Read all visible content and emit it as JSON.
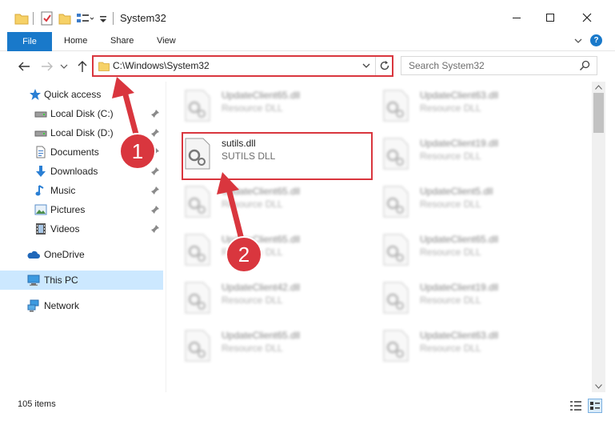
{
  "window": {
    "title": "System32"
  },
  "ribbon": {
    "tabs": [
      "File",
      "Home",
      "Share",
      "View"
    ],
    "help": "?"
  },
  "address_bar": {
    "path": "C:\\Windows\\System32",
    "search_placeholder": "Search System32"
  },
  "sidebar": {
    "items": [
      {
        "label": "Quick access",
        "icon": "star-icon",
        "pinned": false
      },
      {
        "label": "Local Disk (C:)",
        "icon": "drive-icon",
        "pinned": true
      },
      {
        "label": "Local Disk (D:)",
        "icon": "drive-icon",
        "pinned": true
      },
      {
        "label": "Documents",
        "icon": "documents-icon",
        "pinned": true
      },
      {
        "label": "Downloads",
        "icon": "download-icon",
        "pinned": true
      },
      {
        "label": "Music",
        "icon": "music-icon",
        "pinned": true
      },
      {
        "label": "Pictures",
        "icon": "pictures-icon",
        "pinned": true
      },
      {
        "label": "Videos",
        "icon": "videos-icon",
        "pinned": true
      },
      {
        "label": "OneDrive",
        "icon": "cloud-icon",
        "pinned": false
      },
      {
        "label": "This PC",
        "icon": "computer-icon",
        "pinned": false,
        "selected": true
      },
      {
        "label": "Network",
        "icon": "network-icon",
        "pinned": false
      }
    ]
  },
  "files": {
    "left_column": [
      {
        "name": "UpdateClient65.dll",
        "type": "Resource DLL",
        "blurred": true
      },
      {
        "name": "sutils.dll",
        "type": "SUTILS DLL",
        "blurred": false,
        "highlighted": true
      },
      {
        "name": "UpdateClient65.dll",
        "type": "Resource DLL",
        "blurred": true
      },
      {
        "name": "UpdateClient65.dll",
        "type": "Resource DLL",
        "blurred": true
      },
      {
        "name": "UpdateClient42.dll",
        "type": "Resource DLL",
        "blurred": true
      },
      {
        "name": "UpdateClient65.dll",
        "type": "Resource DLL",
        "blurred": true
      }
    ],
    "right_column": [
      {
        "name": "UpdateClient63.dll",
        "type": "Resource DLL",
        "blurred": true
      },
      {
        "name": "UpdateClient19.dll",
        "type": "Resource DLL",
        "blurred": true
      },
      {
        "name": "UpdateClient5.dll",
        "type": "Resource DLL",
        "blurred": true
      },
      {
        "name": "UpdateClient65.dll",
        "type": "Resource DLL",
        "blurred": true
      },
      {
        "name": "UpdateClient19.dll",
        "type": "Resource DLL",
        "blurred": true
      },
      {
        "name": "UpdateClient63.dll",
        "type": "Resource DLL",
        "blurred": true
      }
    ]
  },
  "status": {
    "item_count": "105 items"
  },
  "annotations": {
    "step1": "1",
    "step2": "2",
    "color": "#d9363e"
  }
}
